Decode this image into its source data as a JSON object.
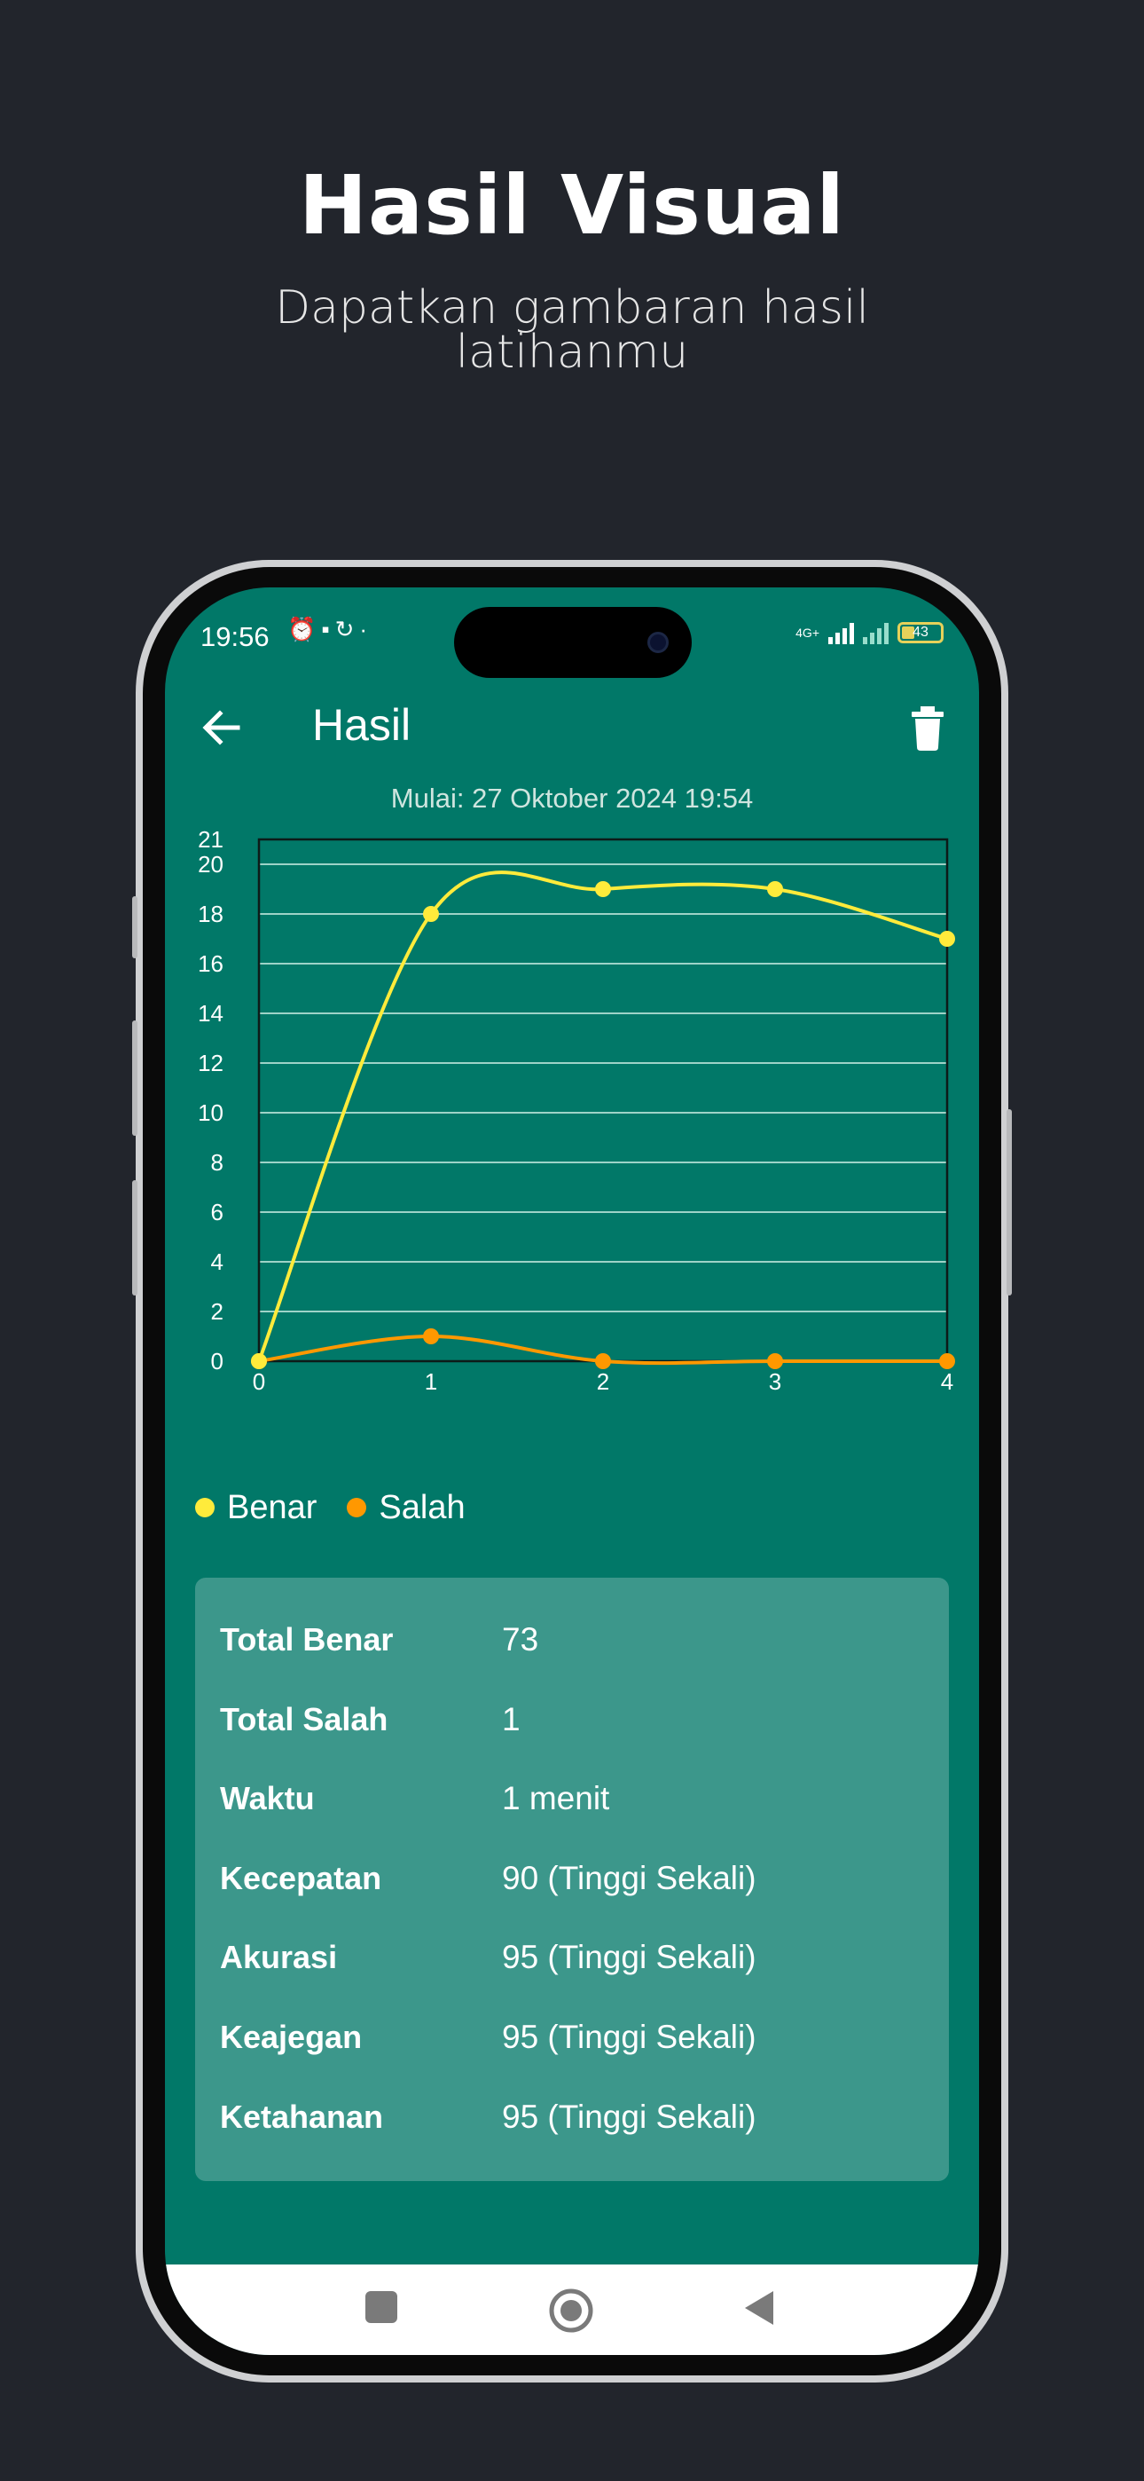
{
  "promo": {
    "title": "Hasil Visual",
    "subtitle": "Dapatkan gambaran hasil latihanmu"
  },
  "status_bar": {
    "time": "19:56",
    "network_label": "4G+",
    "battery": "43",
    "icons": [
      "alarm-icon",
      "notification-icon",
      "sync-icon",
      "dot-icon",
      "signal-icon",
      "battery-icon"
    ]
  },
  "app_bar": {
    "title": "Hasil",
    "back_icon": "arrow-left-icon",
    "delete_icon": "trash-icon"
  },
  "session": {
    "start_text": "Mulai: 27 Oktober 2024 19:54"
  },
  "chart_data": {
    "type": "line",
    "x": [
      0,
      1,
      2,
      3,
      4
    ],
    "x_ticks": [
      "0",
      "1",
      "2",
      "3",
      "4"
    ],
    "y_ticks": [
      "0",
      "2",
      "4",
      "6",
      "8",
      "10",
      "12",
      "14",
      "16",
      "18",
      "20",
      "21"
    ],
    "ylim": [
      0,
      21
    ],
    "xlim": [
      0,
      4
    ],
    "grid": "horizontal",
    "smooth": true,
    "series": [
      {
        "name": "Benar",
        "color": "#ffeb3b",
        "values": [
          0,
          18,
          19,
          19,
          17
        ]
      },
      {
        "name": "Salah",
        "color": "#ff9800",
        "values": [
          0,
          1,
          0,
          0,
          0
        ]
      }
    ],
    "legend_position": "bottom-left"
  },
  "stats": [
    {
      "label": "Total Benar",
      "value": "73"
    },
    {
      "label": "Total Salah",
      "value": "1"
    },
    {
      "label": "Waktu",
      "value": "1 menit"
    },
    {
      "label": "Kecepatan",
      "value": "90 (Tinggi Sekali)"
    },
    {
      "label": "Akurasi",
      "value": "95 (Tinggi Sekali)"
    },
    {
      "label": "Keajegan",
      "value": "95 (Tinggi Sekali)"
    },
    {
      "label": "Ketahanan",
      "value": "95 (Tinggi Sekali)"
    }
  ],
  "nav_bar": {
    "icons": [
      "recents-square-icon",
      "home-circle-icon",
      "back-triangle-icon"
    ]
  },
  "colors": {
    "page_bg": "#22252c",
    "screen_bg": "#017868",
    "card_bg": "#3c978b",
    "correct": "#ffeb3b",
    "wrong": "#ff9800"
  }
}
